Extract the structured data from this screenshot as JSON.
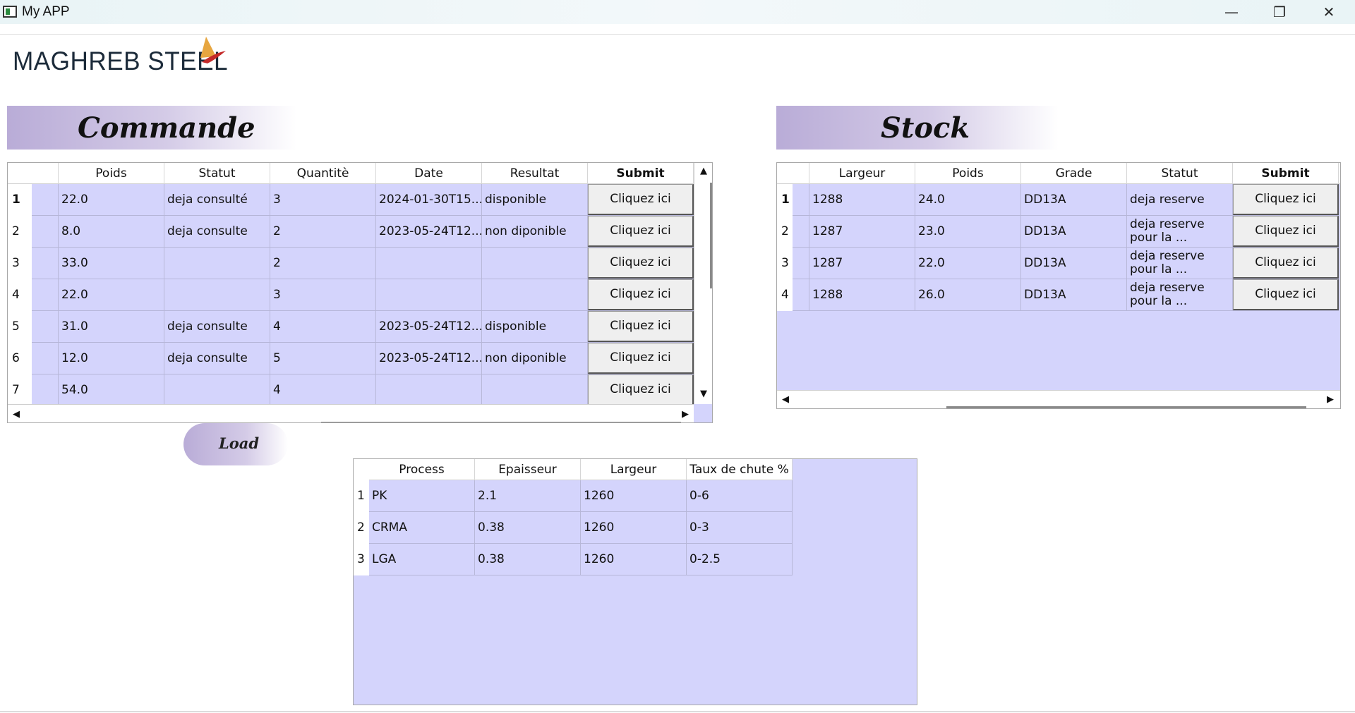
{
  "window": {
    "title": "My APP"
  },
  "logo": {
    "text": "MAGHREB STEEL"
  },
  "commande": {
    "title": "Commande",
    "columns": [
      "Poids",
      "Statut",
      "Quantitè",
      "Date",
      "Resultat",
      "Submit"
    ],
    "rows": [
      {
        "num": "1",
        "poids": "22.0",
        "statut": "deja consulté",
        "quantite": "3",
        "date": "2024-01-30T15...",
        "resultat": " disponible",
        "submit": "Cliquez ici"
      },
      {
        "num": "2",
        "poids": "8.0",
        "statut": " deja consulte",
        "quantite": "2",
        "date": "2023-05-24T12...",
        "resultat": "non diponible",
        "submit": "Cliquez ici"
      },
      {
        "num": "3",
        "poids": "33.0",
        "statut": "",
        "quantite": "2",
        "date": "",
        "resultat": "",
        "submit": "Cliquez ici"
      },
      {
        "num": "4",
        "poids": "22.0",
        "statut": "",
        "quantite": "3",
        "date": "",
        "resultat": "",
        "submit": "Cliquez ici"
      },
      {
        "num": "5",
        "poids": "31.0",
        "statut": " deja consulte",
        "quantite": "4",
        "date": "2023-05-24T12...",
        "resultat": "disponible",
        "submit": "Cliquez ici"
      },
      {
        "num": "6",
        "poids": "12.0",
        "statut": " deja consulte",
        "quantite": "5",
        "date": "2023-05-24T12...",
        "resultat": "non diponible",
        "submit": "Cliquez ici"
      },
      {
        "num": "7",
        "poids": "54.0",
        "statut": "",
        "quantite": "4",
        "date": "",
        "resultat": "",
        "submit": "Cliquez ici"
      }
    ]
  },
  "stock": {
    "title": "Stock",
    "columns": [
      "Largeur",
      "Poids",
      "Grade",
      "Statut",
      "Submit"
    ],
    "rows": [
      {
        "num": "1",
        "largeur": "1288",
        "poids": "24.0",
        "grade": "DD13A",
        "statut": "deja reserve",
        "submit": "Cliquez ici"
      },
      {
        "num": "2",
        "largeur": "1287",
        "poids": "23.0",
        "grade": "DD13A",
        "statut": " deja reserve pour la ...",
        "submit": "Cliquez ici"
      },
      {
        "num": "3",
        "largeur": "1287",
        "poids": "22.0",
        "grade": "DD13A",
        "statut": " deja reserve pour la ...",
        "submit": "Cliquez ici"
      },
      {
        "num": "4",
        "largeur": "1288",
        "poids": "26.0",
        "grade": "DD13A",
        "statut": " deja reserve pour la ...",
        "submit": "Cliquez ici"
      }
    ]
  },
  "load_button": {
    "label": "Load"
  },
  "process": {
    "columns": [
      "Process",
      "Epaisseur",
      "Largeur",
      "Taux de chute %"
    ],
    "rows": [
      {
        "num": "1",
        "process": "PK",
        "epaisseur": "2.1",
        "largeur": "1260",
        "taux": "0-6"
      },
      {
        "num": "2",
        "process": "CRMA",
        "epaisseur": "0.38",
        "largeur": "1260",
        "taux": "0-3"
      },
      {
        "num": "3",
        "process": "LGA",
        "epaisseur": "0.38",
        "largeur": "1260",
        "taux": "0-2.5"
      }
    ]
  }
}
